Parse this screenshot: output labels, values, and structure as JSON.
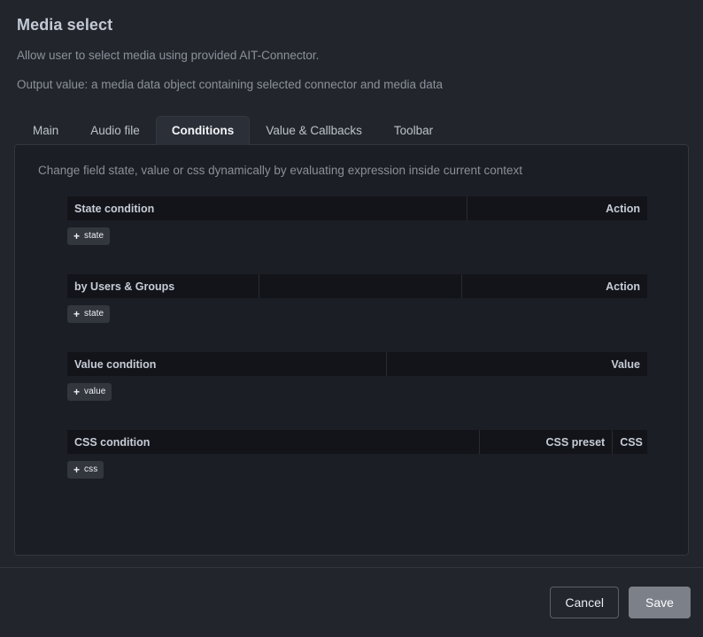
{
  "dialog": {
    "title": "Media select",
    "description_1": "Allow user to select media using provided AIT-Connector.",
    "description_2": "Output value: a media data object containing selected connector and media data"
  },
  "tabs": [
    {
      "label": "Main",
      "active": false
    },
    {
      "label": "Audio file",
      "active": false
    },
    {
      "label": "Conditions",
      "active": true
    },
    {
      "label": "Value & Callbacks",
      "active": false
    },
    {
      "label": "Toolbar",
      "active": false
    }
  ],
  "panel": {
    "hint": "Change field state, value or css dynamically by evaluating expression inside current context",
    "sections": [
      {
        "id": "state-condition",
        "columns": [
          {
            "label": "State condition",
            "align": "left",
            "width": "69%"
          },
          {
            "label": "Action",
            "align": "right",
            "width": "31%"
          }
        ],
        "add_button": {
          "plus": "+",
          "label": "state"
        }
      },
      {
        "id": "users-groups-condition",
        "columns": [
          {
            "label": "by Users & Groups",
            "align": "left",
            "width": "33%"
          },
          {
            "label": "",
            "align": "left",
            "width": "35%"
          },
          {
            "label": "Action",
            "align": "right",
            "width": "32%"
          }
        ],
        "add_button": {
          "plus": "+",
          "label": "state"
        }
      },
      {
        "id": "value-condition",
        "columns": [
          {
            "label": "Value condition",
            "align": "left",
            "width": "55%"
          },
          {
            "label": "Value",
            "align": "right",
            "width": "45%"
          }
        ],
        "add_button": {
          "plus": "+",
          "label": "value"
        }
      },
      {
        "id": "css-condition",
        "columns": [
          {
            "label": "CSS condition",
            "align": "left",
            "width": "71%"
          },
          {
            "label": "CSS preset",
            "align": "right",
            "width": "23%"
          },
          {
            "label": "CSS",
            "align": "right",
            "width": "6%"
          }
        ],
        "add_button": {
          "plus": "+",
          "label": "css"
        }
      }
    ]
  },
  "footer": {
    "cancel_label": "Cancel",
    "save_label": "Save"
  },
  "colors": {
    "window_bg": "#22262c",
    "panel_bg": "#1b1e24",
    "table_header_bg": "#121419",
    "accent_save": "#7b8089",
    "title_text": "#c3c9d4",
    "muted_text": "#8b919b"
  }
}
